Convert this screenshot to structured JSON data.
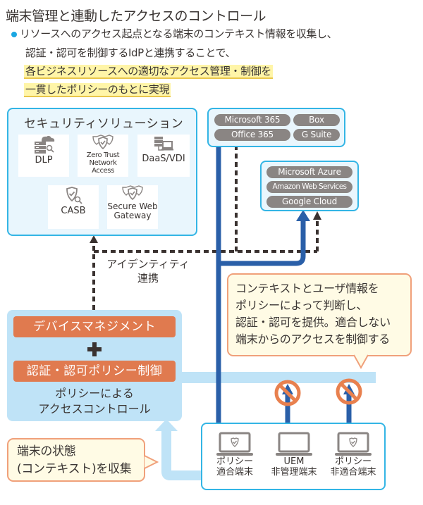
{
  "title": "端末管理と連動したアクセスのコントロール",
  "bullet": {
    "line1": "リソースへのアクセス起点となる端末のコンテキスト情報を収集し、",
    "line2": "認証・認可を制御するIdPと連携することで、",
    "highlight1": "各ビジネスリソースへの適切なアクセス管理・制御を",
    "highlight2": "一貫したポリシーのもとに実現"
  },
  "security_solutions": {
    "title": "セキュリティソリューション",
    "items": [
      {
        "label": "DLP",
        "icon": "server-cloud-search-icon"
      },
      {
        "label": "Zero Trust Network Access",
        "label_line1": "Zero Trust",
        "label_line2": "Network Access",
        "icon": "shield-check-double-icon"
      },
      {
        "label": "DaaS/VDI",
        "icon": "server-laptop-icon"
      },
      {
        "label": "CASB",
        "icon": "shield-check-search-icon"
      },
      {
        "label": "Secure Web Gateway",
        "label_line1": "Secure Web",
        "label_line2": "Gateway",
        "icon": "shield-check-double-icon"
      }
    ]
  },
  "saas": {
    "items": [
      "Microsoft 365",
      "Box",
      "Office 365",
      "G Suite"
    ]
  },
  "cloud": {
    "items": [
      "Microsoft Azure",
      "Amazon Web Services",
      "Google Cloud"
    ]
  },
  "identity_link": {
    "line1": "アイデンティティ",
    "line2": "連携"
  },
  "policy_box": {
    "device_management": "デバイスマネジメント",
    "plus": "+",
    "auth_policy": "認証・認可ポリシー制御",
    "caption_line1": "ポリシーによる",
    "caption_line2": "アクセスコントロール"
  },
  "callout_right": {
    "lines": [
      "コンテキストとユーザ情報を",
      "ポリシーによって判断し、",
      "認証・認可を提供。適合しない",
      "端末からのアクセスを制御する"
    ]
  },
  "callout_left": {
    "lines": [
      "端末の状態",
      "(コンテキスト)を収集"
    ]
  },
  "devices": [
    {
      "line1": "ポリシー",
      "line2": "適合端末",
      "icon": "laptop-shield-icon",
      "blocked": false
    },
    {
      "line1": "UEM",
      "line2": "非管理端末",
      "icon": "laptop-icon",
      "blocked": true
    },
    {
      "line1": "ポリシー",
      "line2": "非適合端末",
      "icon": "laptop-shield-icon",
      "blocked": true
    }
  ],
  "colors": {
    "panel_border": "#33b5e5",
    "panel_fill": "#e9f6fd",
    "policy_fill": "#bfe3f7",
    "orange": "#e07a4f",
    "blue_arrow": "#2a5fa8",
    "dotted_arrow": "#3a3230",
    "pill_gray": "#8a8583",
    "highlight": "#fff5a8"
  }
}
